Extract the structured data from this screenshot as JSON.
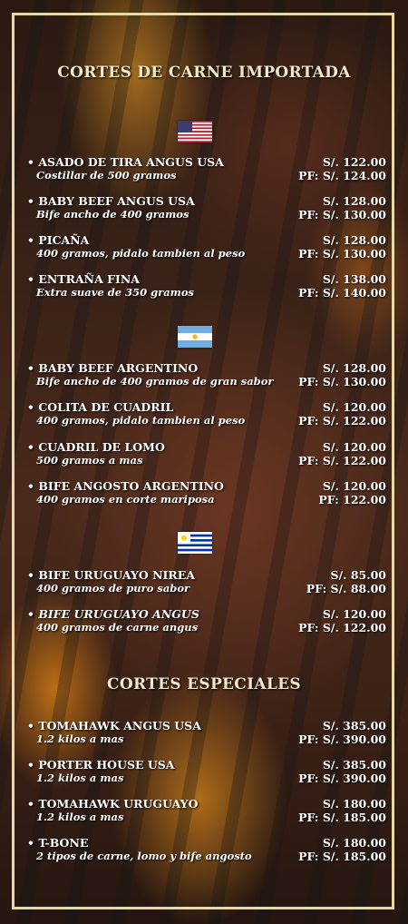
{
  "titles": {
    "imported": "CORTES DE CARNE IMPORTADA",
    "special": "CORTES ESPECIALES"
  },
  "flags": [
    "usa-flag-icon",
    "argentina-flag-icon",
    "uruguay-flag-icon"
  ],
  "usa": [
    {
      "name": "• ASADO DE TIRA ANGUS USA",
      "desc": "Costillar de 500 gramos",
      "price": "S/. 122.00",
      "pf": "PF: S/. 124.00"
    },
    {
      "name": "• BABY BEEF ANGUS USA",
      "desc": "Bife ancho de 400 gramos",
      "price": "S/. 128.00",
      "pf": "PF: S/. 130.00"
    },
    {
      "name": "• PICAÑA",
      "desc": "400 gramos, pidalo tambien al peso",
      "price": "S/. 128.00",
      "pf": "PF: S/. 130.00"
    },
    {
      "name": "• ENTRAÑA FINA",
      "desc": "Extra suave de 350 gramos",
      "price": "S/. 138.00",
      "pf": "PF: S/. 140.00"
    }
  ],
  "argentina": [
    {
      "name": "• BABY BEEF ARGENTINO",
      "desc": "Bife ancho de 400 gramos de gran sabor",
      "price": "S/. 128.00",
      "pf": "PF: S/. 130.00"
    },
    {
      "name": "• COLITA DE CUADRIL",
      "desc": "400 gramos, pidalo tambien al peso",
      "price": "S/. 120.00",
      "pf": "PF: S/. 122.00"
    },
    {
      "name": "• CUADRIL DE LOMO",
      "desc": "500 gramos a mas",
      "price": "S/. 120.00",
      "pf": "PF: S/. 122.00"
    },
    {
      "name": "• BIFE ANGOSTO ARGENTINO",
      "desc": "400 gramos en corte mariposa",
      "price": "S/. 120.00",
      "pf": "PF: 122.00"
    }
  ],
  "uruguay": [
    {
      "name": "• BIFE URUGUAYO NIREA",
      "desc": "400 gramos de puro sabor",
      "price": "S/. 85.00",
      "pf": "PF: S/. 88.00"
    },
    {
      "name": "• BIFE URUGUAYO ANGUS",
      "desc": "400 gramos de carne angus",
      "price": "S/. 120.00",
      "pf": "PF: S/. 122.00"
    }
  ],
  "special": [
    {
      "name": "• TOMAHAWK ANGUS USA",
      "desc": "1.2 kilos a mas",
      "price": "S/. 385.00",
      "pf": "PF: S/. 390.00"
    },
    {
      "name": "• PORTER HOUSE USA",
      "desc": "1.2 kilos a mas",
      "price": "S/. 385.00",
      "pf": "PF: S/. 390.00"
    },
    {
      "name": "• TOMAHAWK URUGUAYO",
      "desc": " 1.2 kilos a mas",
      "price": "S/. 180.00",
      "pf": "PF: S/. 185.00"
    },
    {
      "name": "• T-BONE",
      "desc": "2 tipos de carne, lomo y bife angosto",
      "price": "S/. 180.00",
      "pf": "PF: S/. 185.00"
    }
  ]
}
